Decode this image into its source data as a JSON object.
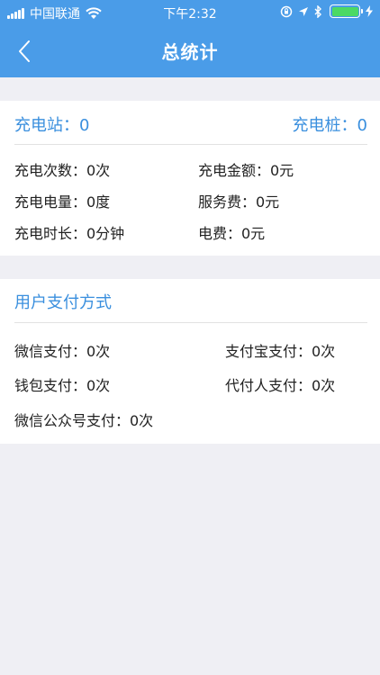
{
  "status_bar": {
    "carrier": "中国联通",
    "time": "下午2:32"
  },
  "nav": {
    "title": "总统计",
    "back_icon": "chevron-left-icon"
  },
  "summary": {
    "station_label": "充电站：0",
    "pile_label": "充电桩：0",
    "stats": {
      "charge_count": "充电次数：0次",
      "charge_amount": "充电金额：0元",
      "charge_energy": "充电电量：0度",
      "service_fee": "服务费：0元",
      "charge_duration": "充电时长：0分钟",
      "electricity_fee": "电费：0元"
    }
  },
  "payment": {
    "title": "用户支付方式",
    "wechat_pay": "微信支付：0次",
    "alipay": "支付宝支付：0次",
    "wallet_pay": "钱包支付：0次",
    "proxy_pay": "代付人支付：0次",
    "wechat_official_pay": "微信公众号支付：0次"
  },
  "colors": {
    "header_bg": "#4a9ce8",
    "accent_text": "#3a8fde",
    "page_bg": "#efeff4",
    "battery": "#4cd964"
  }
}
